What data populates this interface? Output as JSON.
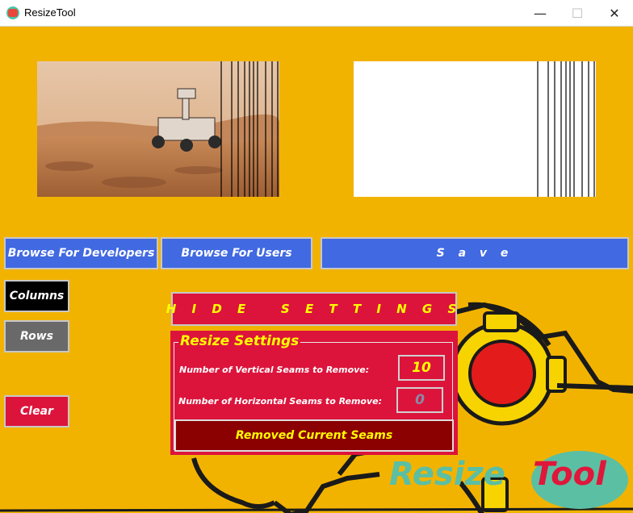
{
  "window": {
    "title": "ResizeTool",
    "controls": {
      "minimize": "—",
      "maximize": "☐",
      "close": "✕"
    }
  },
  "images": {
    "source": {
      "description_icon": "mars-rover-photo"
    },
    "result": {
      "description_icon": "blank-white-canvas"
    }
  },
  "toolbar": {
    "browse_dev": "Browse For Developers",
    "browse_users": "Browse For Users",
    "save": "S a v e"
  },
  "side": {
    "columns": "Columns",
    "rows": "Rows",
    "clear": "Clear"
  },
  "hide_settings": "H I D E   S E T T I N G S",
  "settings": {
    "title": "Resize Settings",
    "vertical_label": "Number of Vertical Seams to Remove:",
    "vertical_value": "10",
    "horizontal_label": "Number of Horizontal Seams to Remove:",
    "horizontal_value": "0",
    "remove_button": "Removed Current Seams"
  },
  "logo": {
    "part1": "Resize",
    "part2": "Tool"
  },
  "colors": {
    "background": "#f2b300",
    "blue_button": "#4169e1",
    "crimson": "#dc143c",
    "dark_red": "#8b0000",
    "yellow_text": "#ffff00"
  }
}
